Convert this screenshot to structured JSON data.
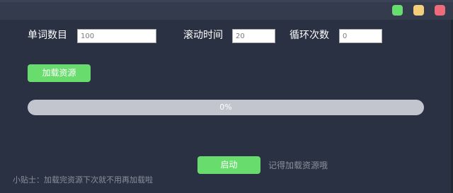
{
  "window": {
    "controls": {
      "minimize_color": "#66dd6e",
      "maximize_color": "#f3cf7c",
      "close_color": "#ee6b7b"
    }
  },
  "settings": {
    "word_count": {
      "label": "单词数目",
      "value": "100"
    },
    "scroll_time": {
      "label": "滚动时间",
      "value": "20"
    },
    "loop_count": {
      "label": "循环次数",
      "value": "0"
    }
  },
  "load_button": {
    "label": "加载资源"
  },
  "progress": {
    "value": 0,
    "text": "0%"
  },
  "start_button": {
    "label": "启动"
  },
  "reminder": "记得加载资源哦",
  "tip": "小贴士：加载完资源下次就不用再加载啦",
  "colors": {
    "background": "#2a3142",
    "accent_green": "#68dd6e",
    "progress_track": "#c3c5ce"
  }
}
